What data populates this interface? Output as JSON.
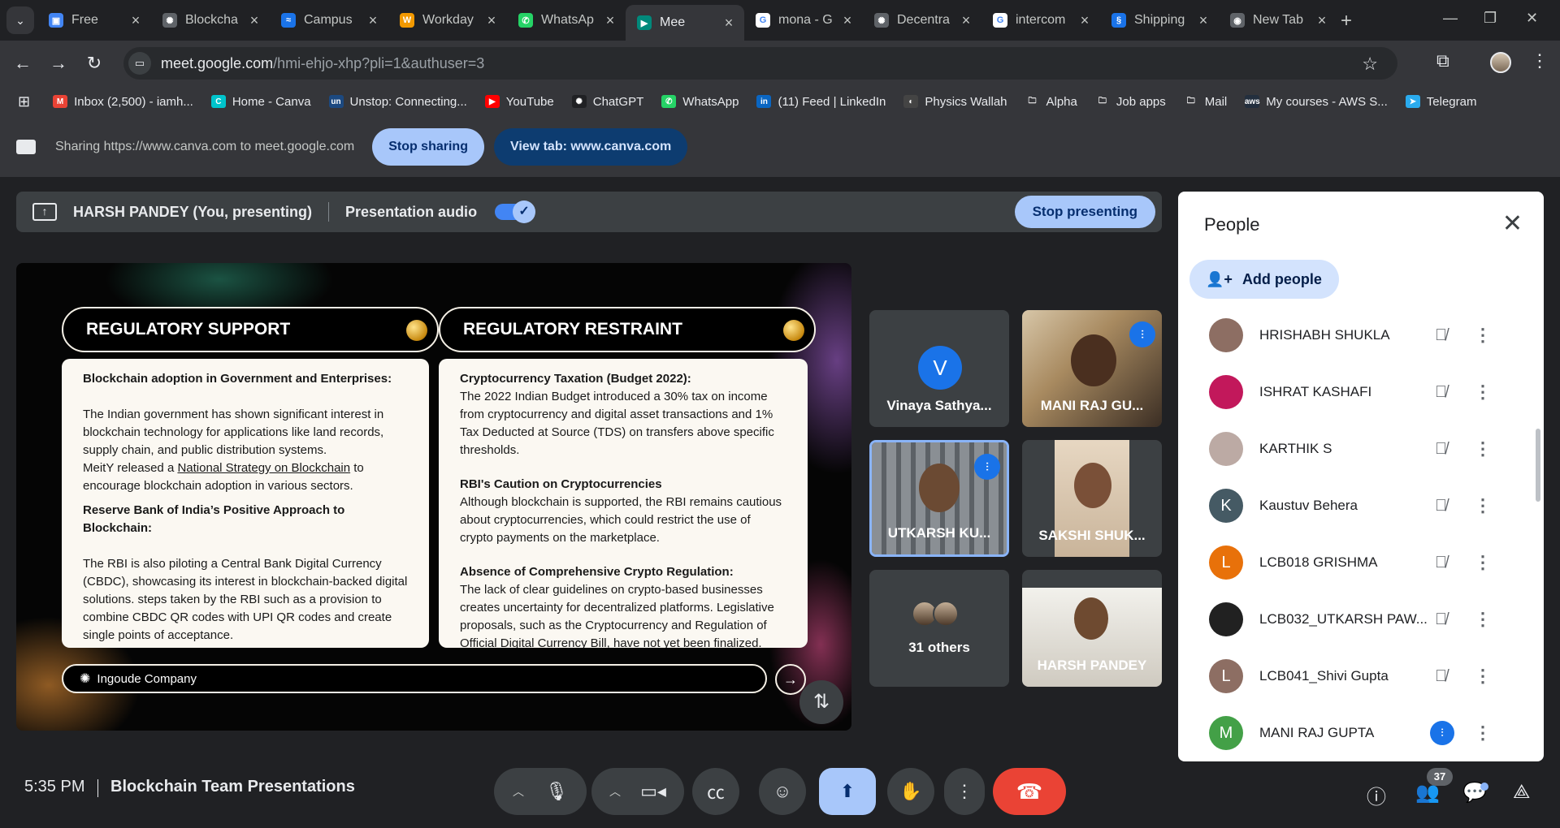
{
  "tabs": [
    {
      "title": "Free",
      "fav_color": "#4285f4",
      "fav": "▣"
    },
    {
      "title": "Blockcha",
      "fav_color": "#5f6368",
      "fav": "✺"
    },
    {
      "title": "Campus",
      "fav_color": "#1a73e8",
      "fav": "≈"
    },
    {
      "title": "Workday",
      "fav_color": "#f29900",
      "fav": "W"
    },
    {
      "title": "WhatsAp",
      "fav_color": "#25d366",
      "fav": "✆"
    },
    {
      "title": "Mee",
      "fav_color": "#00897b",
      "fav": "▶",
      "active": true
    },
    {
      "title": "mona - G",
      "fav_color": "#ffffff",
      "fav": "G"
    },
    {
      "title": "Decentra",
      "fav_color": "#5f6368",
      "fav": "✺"
    },
    {
      "title": "intercom",
      "fav_color": "#ffffff",
      "fav": "G"
    },
    {
      "title": "Shipping",
      "fav_color": "#1a73e8",
      "fav": "§"
    },
    {
      "title": "New Tab",
      "fav_color": "#5f6368",
      "fav": "◉"
    }
  ],
  "address": {
    "host": "meet.google.com",
    "path": "/hmi-ehjo-xhp?pli=1&authuser=3"
  },
  "bookmarks": [
    {
      "label": "Inbox (2,500) - iamh...",
      "icon_color": "#ea4335",
      "icon": "M"
    },
    {
      "label": "Home - Canva",
      "icon_color": "#00c4cc",
      "icon": "C"
    },
    {
      "label": "Unstop: Connecting...",
      "icon_color": "#1c4980",
      "icon": "un"
    },
    {
      "label": "YouTube",
      "icon_color": "#ff0000",
      "icon": "▶"
    },
    {
      "label": "ChatGPT",
      "icon_color": "#202124",
      "icon": "✺"
    },
    {
      "label": "WhatsApp",
      "icon_color": "#25d366",
      "icon": "✆"
    },
    {
      "label": "(11) Feed | LinkedIn",
      "icon_color": "#0a66c2",
      "icon": "in"
    },
    {
      "label": "Physics Wallah",
      "icon_color": "#444",
      "icon": "◐"
    },
    {
      "label": "Alpha",
      "icon_color": "transparent",
      "icon": "🗀"
    },
    {
      "label": "Job apps",
      "icon_color": "transparent",
      "icon": "🗀"
    },
    {
      "label": "Mail",
      "icon_color": "transparent",
      "icon": "🗀"
    },
    {
      "label": "My courses - AWS S...",
      "icon_color": "#232f3e",
      "icon": "aws"
    },
    {
      "label": "Telegram",
      "icon_color": "#2aabee",
      "icon": "➤"
    }
  ],
  "share": {
    "text": "Sharing https://www.canva.com to meet.google.com",
    "stop_label": "Stop sharing",
    "view_label": "View tab: www.canva.com"
  },
  "presenter": {
    "name": "HARSH PANDEY (You, presenting)",
    "audio_label": "Presentation audio",
    "audio_on": true,
    "stop_label": "Stop presenting"
  },
  "slide": {
    "left_title": "REGULATORY SUPPORT",
    "right_title": "REGULATORY RESTRAINT",
    "left": {
      "h1": "Blockchain adoption in Government  and Enterprises:",
      "p1": "The Indian government has shown significant interest in blockchain technology for applications like land records, supply chain, and public distribution systems.",
      "p2_pre": "MeitY released a ",
      "p2_link": "National Strategy on Blockchain",
      "p2_post": " to encourage blockchain adoption in various sectors.",
      "h2": "Reserve Bank of India’s Positive Approach to Blockchain:",
      "p3": "The RBI is also piloting a Central Bank Digital Currency (CBDC), showcasing its interest in blockchain-backed digital solutions. steps taken by the RBI such as a provision to combine CBDC QR codes with UPI QR codes and create single points of acceptance."
    },
    "right": {
      "h1": "Cryptocurrency Taxation (Budget 2022):",
      "p1": "The 2022 Indian Budget introduced a 30% tax on income from cryptocurrency and digital asset transactions and 1% Tax Deducted at Source (TDS) on transfers above specific thresholds.",
      "h2": "RBI's Caution on Cryptocurrencies",
      "p2": "Although blockchain is supported, the RBI remains cautious about cryptocurrencies, which could restrict the use of crypto payments on the marketplace.",
      "h3": "Absence of Comprehensive Crypto Regulation:",
      "p3": "The lack of clear guidelines on crypto-based businesses creates uncertainty for decentralized platforms. Legislative proposals, such as the Cryptocurrency and Regulation of Official Digital Currency Bill, have not yet been finalized."
    },
    "footer": "Ingoude Company"
  },
  "tiles": [
    {
      "name": "Vinaya Sathya...",
      "letter": "V"
    },
    {
      "name": "MANI RAJ GU..."
    },
    {
      "name": "UTKARSH KU..."
    },
    {
      "name": "SAKSHI SHUK..."
    },
    {
      "name": "31 others"
    },
    {
      "name": "HARSH PANDEY"
    }
  ],
  "people_panel": {
    "title": "People",
    "add_label": "Add people",
    "participants": [
      {
        "name": "HRISHABH SHUKLA",
        "avatar_color": "#8d6e63",
        "letter": "",
        "speaking": false
      },
      {
        "name": "ISHRAT KASHAFI",
        "avatar_color": "#c2185b",
        "letter": "",
        "speaking": false
      },
      {
        "name": "KARTHIK S",
        "avatar_color": "#bcaaa4",
        "letter": "",
        "speaking": false
      },
      {
        "name": "Kaustuv Behera",
        "avatar_color": "#455a64",
        "letter": "K",
        "speaking": false
      },
      {
        "name": "LCB018 GRISHMA",
        "avatar_color": "#e8710a",
        "letter": "L",
        "speaking": false
      },
      {
        "name": "LCB032_UTKARSH PAW...",
        "avatar_color": "#212121",
        "letter": "",
        "speaking": false
      },
      {
        "name": "LCB041_Shivi Gupta",
        "avatar_color": "#8d6e63",
        "letter": "L",
        "speaking": false
      },
      {
        "name": "MANI RAJ GUPTA",
        "avatar_color": "#43a047",
        "letter": "M",
        "speaking": true
      }
    ]
  },
  "bottom": {
    "time": "5:35 PM",
    "meeting_name": "Blockchain Team Presentations",
    "participant_count": "37"
  }
}
